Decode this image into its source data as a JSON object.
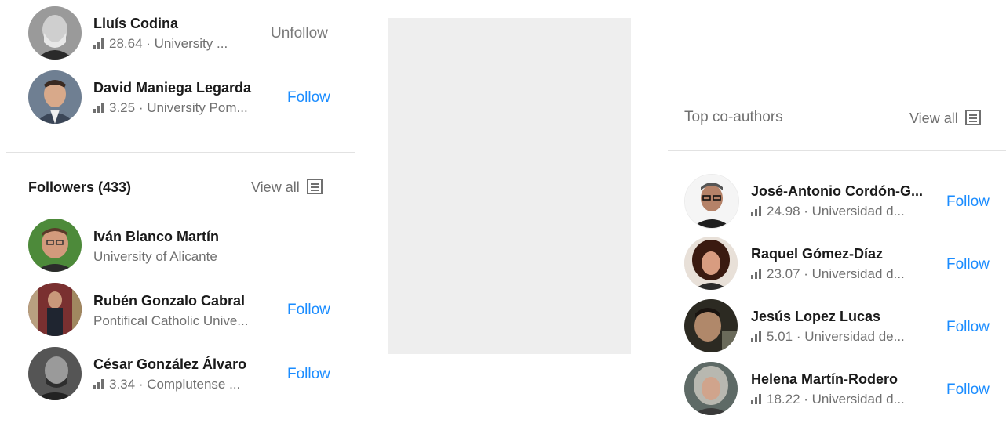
{
  "following": {
    "items": [
      {
        "name": "Lluís Codina",
        "score": "28.64",
        "affiliation": "University ...",
        "action": "Unfollow",
        "has_score": true
      },
      {
        "name": "David Maniega Legarda",
        "score": "3.25",
        "affiliation": "University Pom...",
        "action": "Follow",
        "has_score": true
      }
    ]
  },
  "followers": {
    "title": "Followers (433)",
    "view_all": "View all",
    "items": [
      {
        "name": "Iván Blanco Martín",
        "affiliation": "University of Alicante",
        "action": ""
      },
      {
        "name": "Rubén Gonzalo Cabral",
        "affiliation": "Pontifical Catholic Unive...",
        "action": "Follow"
      },
      {
        "name": "César González Álvaro",
        "score": "3.34",
        "affiliation": "Complutense ...",
        "action": "Follow"
      }
    ]
  },
  "coauthors": {
    "title": "Top co-authors",
    "view_all": "View all",
    "items": [
      {
        "name": "José-Antonio Cordón-G...",
        "score": "24.98",
        "affiliation": "Universidad d...",
        "action": "Follow"
      },
      {
        "name": "Raquel Gómez-Díaz",
        "score": "23.07",
        "affiliation": "Universidad d...",
        "action": "Follow"
      },
      {
        "name": "Jesús Lopez Lucas",
        "score": "5.01",
        "affiliation": "Universidad de...",
        "action": "Follow"
      },
      {
        "name": "Helena Martín-Rodero",
        "score": "18.22",
        "affiliation": "Universidad d...",
        "action": "Follow"
      }
    ]
  },
  "colors": {
    "accent": "#1a8cff",
    "muted": "#707070",
    "placeholder": "#eeeeee"
  },
  "icons": {
    "score": "bar-chart-icon",
    "view_all": "list-icon"
  }
}
